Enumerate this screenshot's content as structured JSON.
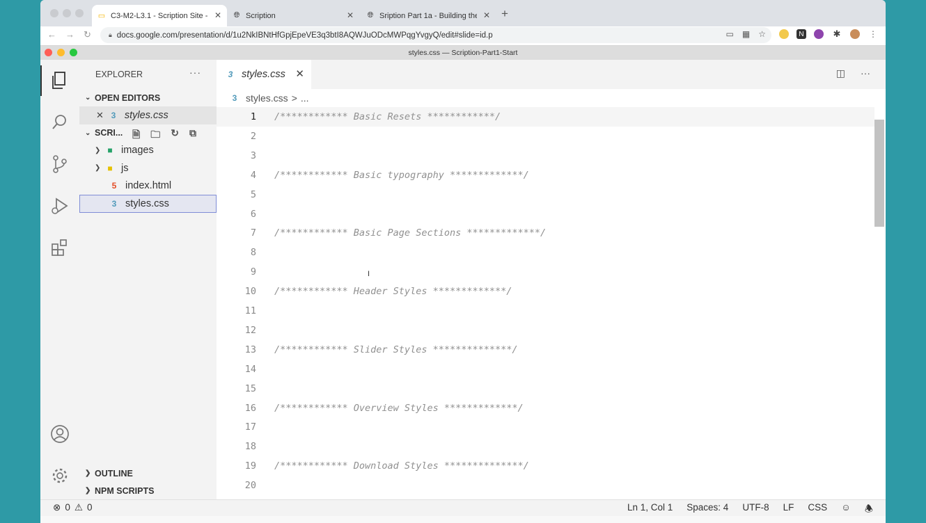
{
  "browser": {
    "tabs": [
      {
        "title": "C3-M2-L3.1 - Scription Site - F",
        "icon": "google-slides-icon"
      },
      {
        "title": "Scription",
        "icon": "globe-icon"
      },
      {
        "title": "Sription Part 1a - Building the",
        "icon": "globe-icon"
      }
    ],
    "new_tab": "+",
    "url": "docs.google.com/presentation/d/1u2NkIBNtHfGpjEpeVE3q3btI8AQWJuODcMWPqgYvgyQ/edit#slide=id.p"
  },
  "vscode": {
    "window_title": "styles.css — Scription-Part1-Start",
    "sidebar": {
      "title": "EXPLORER",
      "more": "···",
      "open_editors_label": "OPEN EDITORS",
      "open_editors": [
        {
          "name": "styles.css"
        }
      ],
      "folder_label": "SCRI...",
      "files": [
        {
          "name": "images",
          "type": "folder"
        },
        {
          "name": "js",
          "type": "folder"
        },
        {
          "name": "index.html",
          "type": "html"
        },
        {
          "name": "styles.css",
          "type": "css"
        }
      ],
      "outline_label": "OUTLINE",
      "npm_label": "NPM SCRIPTS"
    },
    "editor": {
      "tab_label": "styles.css",
      "breadcrumb_file": "styles.css",
      "breadcrumb_sep": ">",
      "breadcrumb_more": "...",
      "lines": [
        {
          "n": "1",
          "text": "/************ Basic Resets ************/"
        },
        {
          "n": "2",
          "text": ""
        },
        {
          "n": "3",
          "text": ""
        },
        {
          "n": "4",
          "text": "/************ Basic typography *************/"
        },
        {
          "n": "5",
          "text": ""
        },
        {
          "n": "6",
          "text": ""
        },
        {
          "n": "7",
          "text": "/************ Basic Page Sections *************/"
        },
        {
          "n": "8",
          "text": ""
        },
        {
          "n": "9",
          "text": ""
        },
        {
          "n": "10",
          "text": "/************ Header Styles *************/"
        },
        {
          "n": "11",
          "text": ""
        },
        {
          "n": "12",
          "text": ""
        },
        {
          "n": "13",
          "text": "/************ Slider Styles **************/"
        },
        {
          "n": "14",
          "text": ""
        },
        {
          "n": "15",
          "text": ""
        },
        {
          "n": "16",
          "text": "/************ Overview Styles *************/"
        },
        {
          "n": "17",
          "text": ""
        },
        {
          "n": "18",
          "text": ""
        },
        {
          "n": "19",
          "text": "/************ Download Styles **************/"
        },
        {
          "n": "20",
          "text": ""
        }
      ]
    },
    "status": {
      "errors": "0",
      "warnings": "0",
      "position": "Ln 1, Col 1",
      "spaces": "Spaces: 4",
      "encoding": "UTF-8",
      "eol": "LF",
      "language": "CSS"
    }
  }
}
